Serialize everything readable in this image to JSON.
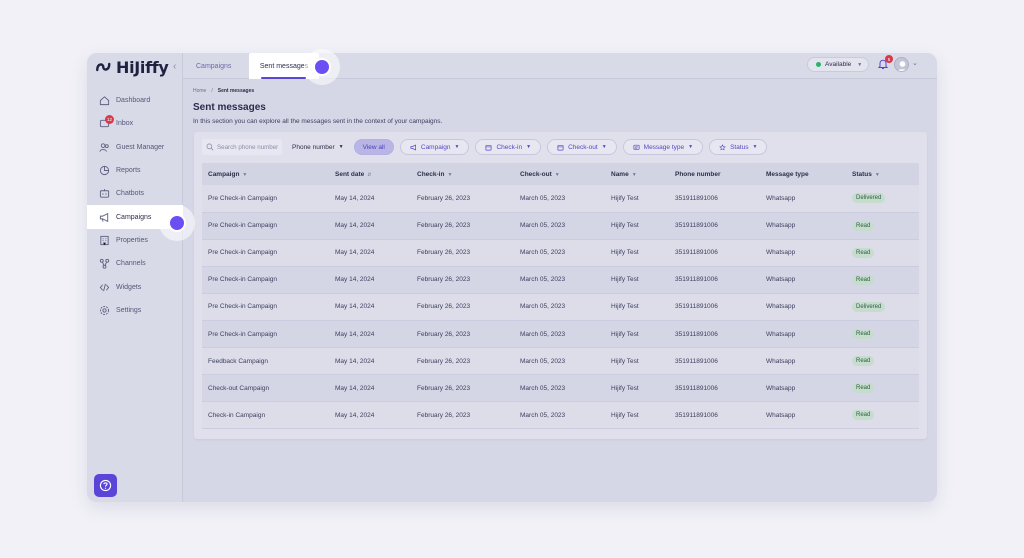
{
  "app": {
    "logo_text": "HiJiffy"
  },
  "sidebar": {
    "items": [
      {
        "label": "Dashboard",
        "icon": "home-icon"
      },
      {
        "label": "Inbox",
        "icon": "inbox-icon",
        "badge": "12"
      },
      {
        "label": "Guest Manager",
        "icon": "users-icon"
      },
      {
        "label": "Reports",
        "icon": "chart-icon"
      },
      {
        "label": "Chatbots",
        "icon": "chatbot-icon"
      },
      {
        "label": "Campaigns",
        "icon": "megaphone-icon",
        "active": true
      },
      {
        "label": "Properties",
        "icon": "building-icon"
      },
      {
        "label": "Channels",
        "icon": "channels-icon"
      },
      {
        "label": "Widgets",
        "icon": "code-icon"
      },
      {
        "label": "Settings",
        "icon": "gear-icon"
      }
    ],
    "help_icon": "question-icon"
  },
  "topbar": {
    "tabs": [
      {
        "label": "Campaigns"
      },
      {
        "label": "Sent messages",
        "active": true
      }
    ],
    "availability": "Available",
    "notifications_count": "5"
  },
  "breadcrumb": {
    "home": "Home",
    "separator": "/",
    "current": "Sent messages"
  },
  "page": {
    "title": "Sent messages",
    "description": "In this section you can explore all the messages sent in the context of your campaigns."
  },
  "filters": {
    "search_placeholder": "Search phone number",
    "search_field": "Phone number",
    "view_all": "View all",
    "campaign": "Campaign",
    "checkin": "Check-in",
    "checkout": "Check-out",
    "message_type": "Message type",
    "status": "Status"
  },
  "table": {
    "columns": [
      "Campaign",
      "Sent date",
      "Check-in",
      "Check-out",
      "Name",
      "Phone number",
      "Message type",
      "Status"
    ],
    "rows": [
      [
        "Pre Check-in Campaign",
        "May 14, 2024",
        "February 26, 2023",
        "March 05, 2023",
        "Hijify Test",
        "351911891006",
        "Whatsapp",
        "Delivered"
      ],
      [
        "Pre Check-in Campaign",
        "May 14, 2024",
        "February 26, 2023",
        "March 05, 2023",
        "Hijify Test",
        "351911891006",
        "Whatsapp",
        "Read"
      ],
      [
        "Pre Check-in Campaign",
        "May 14, 2024",
        "February 26, 2023",
        "March 05, 2023",
        "Hijify Test",
        "351911891006",
        "Whatsapp",
        "Read"
      ],
      [
        "Pre Check-in Campaign",
        "May 14, 2024",
        "February 26, 2023",
        "March 05, 2023",
        "Hijify Test",
        "351911891006",
        "Whatsapp",
        "Read"
      ],
      [
        "Pre Check-in Campaign",
        "May 14, 2024",
        "February 26, 2023",
        "March 05, 2023",
        "Hijify Test",
        "351911891006",
        "Whatsapp",
        "Delivered"
      ],
      [
        "Pre Check-in Campaign",
        "May 14, 2024",
        "February 26, 2023",
        "March 05, 2023",
        "Hijify Test",
        "351911891006",
        "Whatsapp",
        "Read"
      ],
      [
        "Feedback Campaign",
        "May 14, 2024",
        "February 26, 2023",
        "March 05, 2023",
        "Hijify Test",
        "351911891006",
        "Whatsapp",
        "Read"
      ],
      [
        "Check-out Campaign",
        "May 14, 2024",
        "February 26, 2023",
        "March 05, 2023",
        "Hijify Test",
        "351911891006",
        "Whatsapp",
        "Read"
      ],
      [
        "Check-in Campaign",
        "May 14, 2024",
        "February 26, 2023",
        "March 05, 2023",
        "Hijify Test",
        "351911891006",
        "Whatsapp",
        "Read"
      ]
    ]
  }
}
